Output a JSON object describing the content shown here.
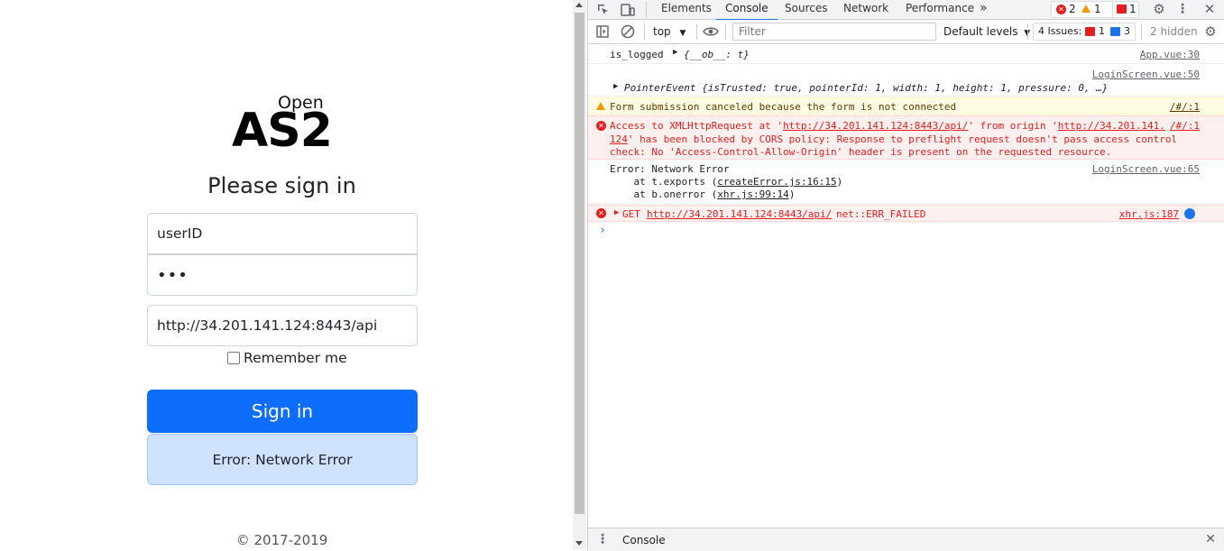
{
  "app": {
    "brand_small": "Open",
    "brand_big": "AS2",
    "heading": "Please sign in",
    "user_value": "userID",
    "password_value": "•••",
    "url_value": "http://34.201.141.124:8443/api",
    "remember_label": "Remember me",
    "signin_label": "Sign in",
    "error_text": "Error: Network Error",
    "footer": "© 2017-2019"
  },
  "devtools": {
    "tabs": [
      "Elements",
      "Console",
      "Sources",
      "Network",
      "Performance"
    ],
    "more_tabs": "»",
    "error_count": "2",
    "warning_count": "1",
    "issue_count_top": "1",
    "context": "top",
    "filter_placeholder": "Filter",
    "levels": "Default levels",
    "issues_label": "4 Issues:",
    "issues_err": "1",
    "issues_info": "3",
    "hidden": "2 hidden",
    "drawer_tab": "Console",
    "colors": {
      "accent": "#1a73e8",
      "error": "#e41e1e",
      "warning": "#f29900",
      "button": "#0d6efd"
    }
  },
  "console": {
    "m1_text": "is_logged",
    "m1_obj": "{__ob__: t}",
    "m1_src": "App.vue:30",
    "m2_src": "LoginScreen.vue:50",
    "m2_text": "PointerEvent {isTrusted: true, pointerId: 1, width: 1, height: 1, pressure: 0, …}",
    "m3_text": "Form submission canceled because the form is not connected",
    "m3_src": "/#/:1",
    "m4_l1a": "Access to XMLHttpRequest at '",
    "m4_l1b": "http://34.201.141.124:8443/api/",
    "m4_l1c": "' from origin '",
    "m4_l1d": "http://34.201.141.",
    "m4_src": "/#/:1",
    "m4_l2a": "124",
    "m4_l2b": "' has been blocked by CORS policy: Response to preflight request doesn't pass access control",
    "m4_l3": "check: No 'Access-Control-Allow-Origin' header is present on the requested resource.",
    "m5_l1": "Error: Network Error",
    "m5_src": "LoginScreen.vue:65",
    "m5_l2a": "    at t.exports (",
    "m5_l2b": "createError.js:16:15",
    "m5_l2c": ")",
    "m5_l3a": "    at b.onerror (",
    "m5_l3b": "xhr.js:99:14",
    "m5_l3c": ")",
    "m6_a": "GET",
    "m6_b": "http://34.201.141.124:8443/api/",
    "m6_c": "net::ERR_FAILED",
    "m6_src": "xhr.js:187"
  }
}
